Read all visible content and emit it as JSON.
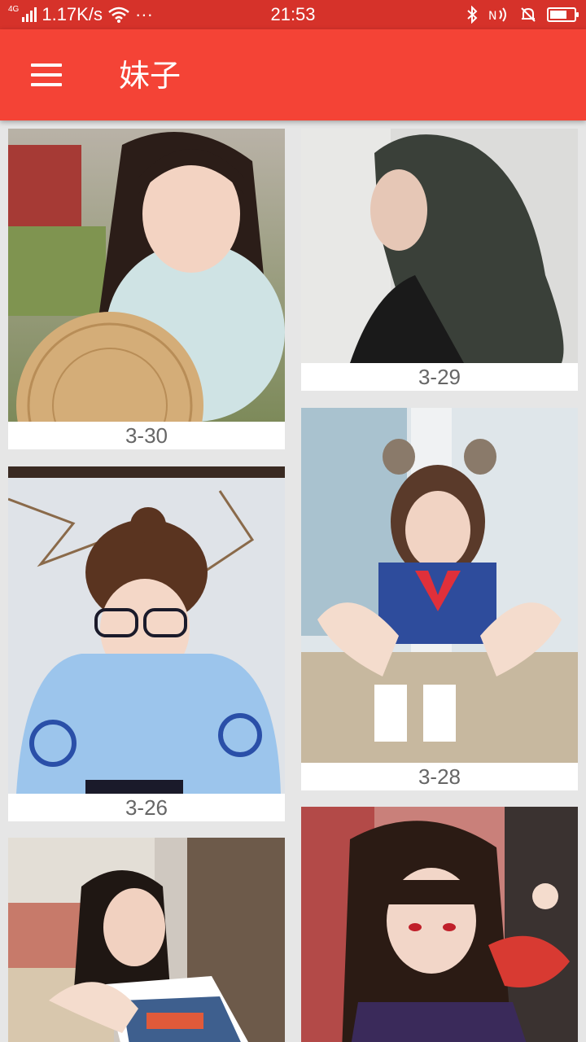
{
  "status_bar": {
    "network_type": "4G",
    "speed": "1.17K/s",
    "more": "···",
    "time": "21:53",
    "bluetooth_icon": "bluetooth-icon",
    "nfc_icon": "nfc-icon",
    "silent_icon": "bell-off-icon",
    "battery_level": 0.7
  },
  "app_bar": {
    "menu_icon": "hamburger-menu-icon",
    "title": "妹子",
    "color": "#f44336"
  },
  "cards": [
    {
      "date": "3-30",
      "photo": "girl-with-bamboo-fan"
    },
    {
      "date": "3-29",
      "photo": "girl-with-long-wavy-hair"
    },
    {
      "date": "3-26",
      "photo": "girl-with-glasses-in-snow"
    },
    {
      "date": "3-28",
      "photo": "girl-in-sailor-uniform"
    },
    {
      "date": "",
      "photo": "girl-in-overalls"
    },
    {
      "date": "",
      "photo": "girl-in-kimono-cosplay"
    }
  ]
}
